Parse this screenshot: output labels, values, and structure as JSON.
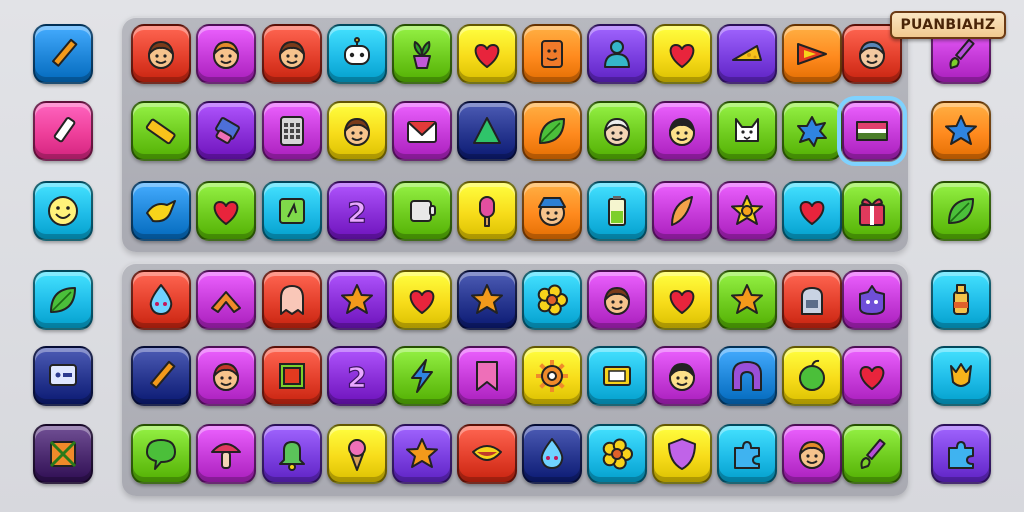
{
  "logo": {
    "text": "PUANBIAHZ"
  },
  "palette": {
    "red": "#e4402c",
    "magenta": "#c63bd9",
    "orange": "#ff8a1e",
    "cyan": "#1fbce8",
    "lime": "#6fcc1f",
    "yellow": "#f7dc1a",
    "purple": "#7b3fe0",
    "navy": "#27368f",
    "pink": "#ee3f9a",
    "blue": "#1f86d9",
    "violet": "#8a2fd8",
    "plum": "#4b2a6f"
  },
  "left_column": [
    {
      "color": "blue",
      "icon": "pencil-icon"
    },
    {
      "color": "pink",
      "icon": "paint-tube-icon"
    },
    {
      "color": "cyan",
      "icon": "smiley-face-icon"
    },
    {
      "color": "cyan",
      "icon": "leaf-icon"
    },
    {
      "color": "navy",
      "icon": "monitor-icon"
    },
    {
      "color": "plum",
      "icon": "crate-icon"
    }
  ],
  "right_column": [
    {
      "color": "magenta",
      "icon": "paintbrush-icon"
    },
    {
      "color": "orange",
      "icon": "blue-star-icon"
    },
    {
      "color": "lime",
      "icon": "leaf-icon"
    },
    {
      "color": "cyan",
      "icon": "bottle-icon"
    },
    {
      "color": "cyan",
      "icon": "tulip-icon"
    },
    {
      "color": "purple",
      "icon": "puzzle-piece-icon"
    }
  ],
  "grid_top": [
    [
      {
        "color": "red",
        "icon": "boy-face-icon"
      },
      {
        "color": "magenta",
        "icon": "girl-face-icon"
      },
      {
        "color": "red",
        "icon": "boy-face-icon"
      },
      {
        "color": "cyan",
        "icon": "robot-face-icon"
      },
      {
        "color": "lime",
        "icon": "flower-pot-icon"
      },
      {
        "color": "yellow",
        "icon": "heart-icon"
      },
      {
        "color": "orange",
        "icon": "notebook-icon"
      },
      {
        "color": "purple",
        "icon": "blob-figure-icon"
      },
      {
        "color": "yellow",
        "icon": "heart-icon"
      },
      {
        "color": "purple",
        "icon": "cheese-icon"
      },
      {
        "color": "orange",
        "icon": "pennant-icon"
      },
      {
        "color": "red",
        "icon": "woman-face-icon"
      }
    ],
    [
      {
        "color": "lime",
        "icon": "ruler-icon"
      },
      {
        "color": "violet",
        "icon": "eraser-icon"
      },
      {
        "color": "magenta",
        "icon": "calculator-icon"
      },
      {
        "color": "yellow",
        "icon": "boy-face-icon"
      },
      {
        "color": "magenta",
        "icon": "envelope-icon"
      },
      {
        "color": "navy",
        "icon": "triangle-icon"
      },
      {
        "color": "orange",
        "icon": "leaf-icon"
      },
      {
        "color": "lime",
        "icon": "grandpa-face-icon"
      },
      {
        "color": "magenta",
        "icon": "round-face-icon"
      },
      {
        "color": "lime",
        "icon": "cat-face-icon"
      },
      {
        "color": "lime",
        "icon": "splat-icon"
      },
      {
        "color": "magenta",
        "icon": "flag-icon",
        "selected": true
      }
    ],
    [
      {
        "color": "blue",
        "icon": "bird-icon"
      },
      {
        "color": "lime",
        "icon": "heart-icon"
      },
      {
        "color": "cyan",
        "icon": "map-icon"
      },
      {
        "color": "violet",
        "icon": "number-two-icon"
      },
      {
        "color": "lime",
        "icon": "mug-icon"
      },
      {
        "color": "yellow",
        "icon": "popsicle-icon"
      },
      {
        "color": "orange",
        "icon": "hat-face-icon"
      },
      {
        "color": "cyan",
        "icon": "battery-icon"
      },
      {
        "color": "magenta",
        "icon": "feather-icon"
      },
      {
        "color": "magenta",
        "icon": "sun-icon"
      },
      {
        "color": "cyan",
        "icon": "heart-icon"
      },
      {
        "color": "lime",
        "icon": "gift-icon"
      }
    ]
  ],
  "grid_bottom": [
    [
      {
        "color": "red",
        "icon": "drop-creature-icon"
      },
      {
        "color": "magenta",
        "icon": "chevron-up-icon"
      },
      {
        "color": "red",
        "icon": "ghost-icon"
      },
      {
        "color": "violet",
        "icon": "star-icon"
      },
      {
        "color": "yellow",
        "icon": "heart-icon"
      },
      {
        "color": "navy",
        "icon": "star-icon"
      },
      {
        "color": "cyan",
        "icon": "flower-icon"
      },
      {
        "color": "magenta",
        "icon": "boy-face-icon"
      },
      {
        "color": "yellow",
        "icon": "heart-icon"
      },
      {
        "color": "lime",
        "icon": "star-icon"
      },
      {
        "color": "red",
        "icon": "mailbox-icon"
      },
      {
        "color": "magenta",
        "icon": "monster-icon"
      }
    ],
    [
      {
        "color": "navy",
        "icon": "pencil-icon"
      },
      {
        "color": "magenta",
        "icon": "elf-face-icon"
      },
      {
        "color": "red",
        "icon": "frame-icon"
      },
      {
        "color": "violet",
        "icon": "number-two-icon"
      },
      {
        "color": "lime",
        "icon": "lightning-icon"
      },
      {
        "color": "magenta",
        "icon": "bookmark-icon"
      },
      {
        "color": "yellow",
        "icon": "gear-icon"
      },
      {
        "color": "cyan",
        "icon": "screen-icon"
      },
      {
        "color": "magenta",
        "icon": "round-face-icon"
      },
      {
        "color": "blue",
        "icon": "arch-icon"
      },
      {
        "color": "yellow",
        "icon": "apple-icon"
      },
      {
        "color": "magenta",
        "icon": "heart-icon"
      }
    ],
    [
      {
        "color": "lime",
        "icon": "speech-bubble-icon"
      },
      {
        "color": "magenta",
        "icon": "mushroom-icon"
      },
      {
        "color": "purple",
        "icon": "bell-icon"
      },
      {
        "color": "yellow",
        "icon": "ice-cream-icon"
      },
      {
        "color": "purple",
        "icon": "star-icon"
      },
      {
        "color": "red",
        "icon": "mouth-icon"
      },
      {
        "color": "navy",
        "icon": "drop-creature-icon"
      },
      {
        "color": "cyan",
        "icon": "flower-icon"
      },
      {
        "color": "yellow",
        "icon": "shield-icon"
      },
      {
        "color": "cyan",
        "icon": "puzzle-piece-icon"
      },
      {
        "color": "magenta",
        "icon": "girl-face-icon"
      },
      {
        "color": "lime",
        "icon": "paintbrush-icon"
      }
    ]
  ]
}
